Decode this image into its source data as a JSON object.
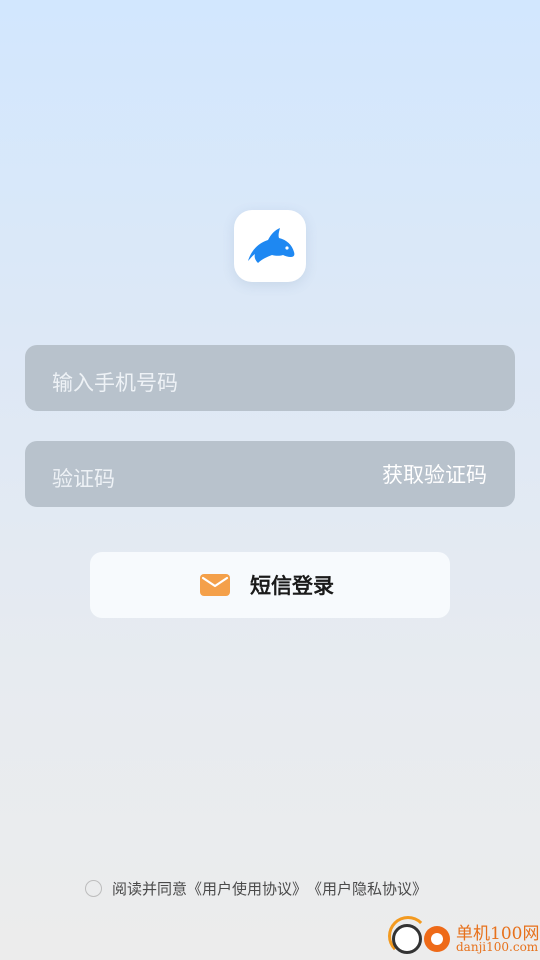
{
  "login": {
    "phone_placeholder": "输入手机号码",
    "code_placeholder": "验证码",
    "get_code_label": "获取验证码",
    "sms_login_label": "短信登录"
  },
  "agreement": {
    "prefix": "阅读并同意",
    "user_agreement": "《用户使用协议》",
    "privacy_agreement": "《用户隐私协议》"
  },
  "watermark": {
    "title": "单机100网",
    "url": "danji100.com"
  },
  "icons": {
    "logo": "dolphin-icon",
    "sms": "mail-icon",
    "checkbox": "radio-circle-icon"
  },
  "colors": {
    "brand_blue": "#1e88f2",
    "mail_orange": "#f4a04a",
    "field_bg": "#b8c2cc",
    "watermark_orange": "#e7711b"
  }
}
